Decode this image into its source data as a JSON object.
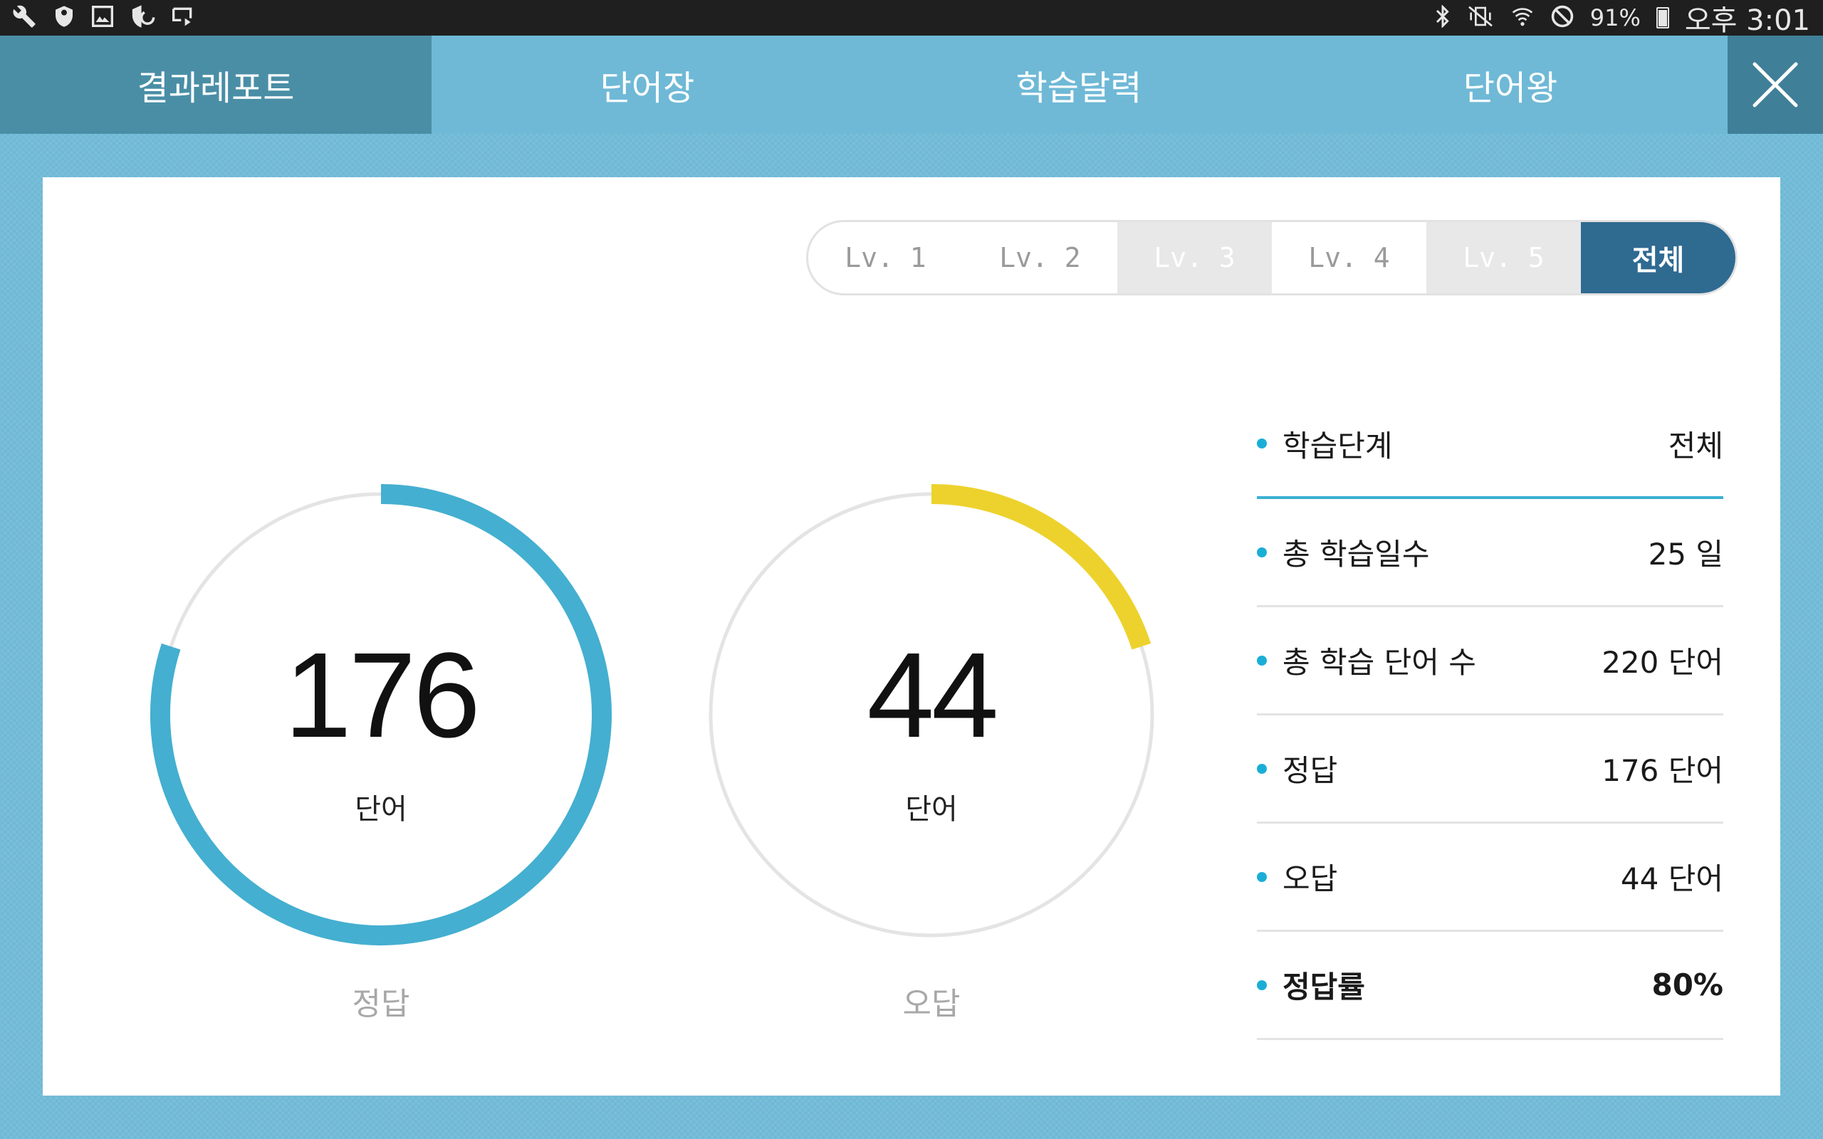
{
  "status_bar": {
    "left_icons": [
      "wrench-icon",
      "shield-icon",
      "image-icon",
      "shield-refresh-icon",
      "screen-mirror-icon"
    ],
    "right_icons": [
      "bluetooth-icon",
      "vibrate-mute-icon",
      "wifi-icon",
      "block-icon"
    ],
    "battery": "91%",
    "time": "오후 3:01"
  },
  "tabs": [
    {
      "label": "결과레포트",
      "active": true
    },
    {
      "label": "단어장",
      "active": false
    },
    {
      "label": "학습달력",
      "active": false
    },
    {
      "label": "단어왕",
      "active": false
    }
  ],
  "levels": [
    {
      "label": "Lv. 1",
      "state": "normal"
    },
    {
      "label": "Lv. 2",
      "state": "normal"
    },
    {
      "label": "Lv. 3",
      "state": "disabled"
    },
    {
      "label": "Lv. 4",
      "state": "normal"
    },
    {
      "label": "Lv. 5",
      "state": "disabled"
    },
    {
      "label": "전체",
      "state": "selected"
    }
  ],
  "gauges": [
    {
      "value": "176",
      "unit": "단어",
      "caption": "정답",
      "fraction": 0.8,
      "color": "#44afd0"
    },
    {
      "value": "44",
      "unit": "단어",
      "caption": "오답",
      "fraction": 0.2,
      "color": "#edd22d"
    }
  ],
  "stats": [
    {
      "label": "학습단계",
      "value": "전체"
    },
    {
      "label": "총 학습일수",
      "value": "25 일"
    },
    {
      "label": "총 학습 단어 수",
      "value": "220 단어"
    },
    {
      "label": "정답",
      "value": "176 단어"
    },
    {
      "label": "오답",
      "value": "44 단어"
    },
    {
      "label": "정답률",
      "value": "80%"
    }
  ]
}
